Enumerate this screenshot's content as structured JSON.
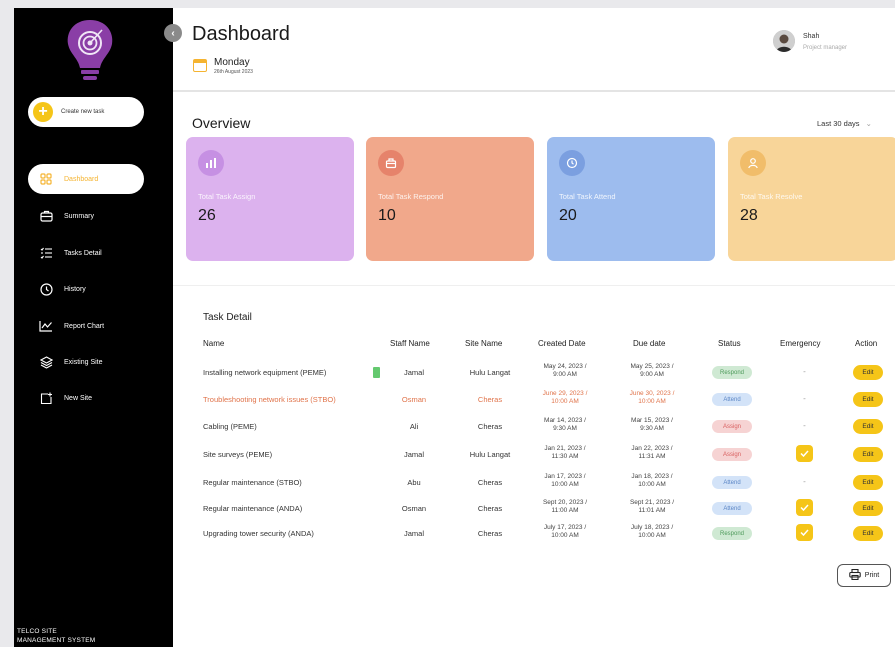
{
  "sidebar": {
    "create_label": "Create new task",
    "items": [
      {
        "label": "Dashboard",
        "icon": "grid-icon"
      },
      {
        "label": "Summary",
        "icon": "briefcase-icon"
      },
      {
        "label": "Tasks Detail",
        "icon": "list-icon"
      },
      {
        "label": "History",
        "icon": "clock-icon"
      },
      {
        "label": "Report Chart",
        "icon": "line-chart-icon"
      },
      {
        "label": "Existing Site",
        "icon": "layers-icon"
      },
      {
        "label": "New Site",
        "icon": "new-site-icon"
      }
    ],
    "footer_line1": "TELCO SITE",
    "footer_line2": "MANAGEMENT SYSTEM"
  },
  "header": {
    "title": "Dashboard",
    "day": "Monday",
    "date": "26th August 2023",
    "user_name": "Shah",
    "user_role": "Project manager"
  },
  "overview": {
    "title": "Overview",
    "range": "Last 30 days",
    "cards": [
      {
        "label": "Total Task Assign",
        "value": "26",
        "bg": "#dcb2ee",
        "icon_bg": "#c690e3"
      },
      {
        "label": "Total Task Respond",
        "value": "10",
        "bg": "#f1a88b",
        "icon_bg": "#e6836b"
      },
      {
        "label": "Total Task Attend",
        "value": "20",
        "bg": "#9dbcee",
        "icon_bg": "#7b9fe0"
      },
      {
        "label": "Total Task Resolve",
        "value": "28",
        "bg": "#f8d599",
        "icon_bg": "#f1bd6a"
      }
    ]
  },
  "task_detail": {
    "title": "Task Detail",
    "columns": [
      "Name",
      "Staff Name",
      "Site Name",
      "Created Date",
      "Due date",
      "Status",
      "Emergency",
      "Action"
    ],
    "rows": [
      {
        "name": "Installing network equipment (PEME)",
        "staff": "Jamal",
        "site": "Hulu Langat",
        "created1": "May 24, 2023 /",
        "created2": "9:00 AM",
        "due1": "May 25, 2023 /",
        "due2": "9:00 AM",
        "status": "Respond",
        "emergency": false,
        "action": "Edit"
      },
      {
        "name": "Troubleshooting network issues (STBO)",
        "staff": "Osman",
        "site": "Cheras",
        "created1": "June 29, 2023 /",
        "created2": "10:00 AM",
        "due1": "June 30, 2023 /",
        "due2": "10:00 AM",
        "status": "Attend",
        "emergency": false,
        "action": "Edit"
      },
      {
        "name": "Cabling (PEME)",
        "staff": "Ali",
        "site": "Cheras",
        "created1": "Mar 14, 2023 /",
        "created2": "9:30 AM",
        "due1": "Mar 15, 2023 /",
        "due2": "9:30 AM",
        "status": "Assign",
        "emergency": false,
        "action": "Edit"
      },
      {
        "name": "Site surveys (PEME)",
        "staff": "Jamal",
        "site": "Hulu Langat",
        "created1": "Jan 21, 2023 /",
        "created2": "11:30 AM",
        "due1": "Jan 22, 2023 /",
        "due2": "11:31 AM",
        "status": "Assign",
        "emergency": true,
        "action": "Edit"
      },
      {
        "name": "Regular maintenance (STBO)",
        "staff": "Abu",
        "site": "Cheras",
        "created1": "Jan 17, 2023 /",
        "created2": "10:00 AM",
        "due1": "Jan 18, 2023 /",
        "due2": "10:00 AM",
        "status": "Attend",
        "emergency": false,
        "action": "Edit"
      },
      {
        "name": "Regular maintenance (ANDA)",
        "staff": "Osman",
        "site": "Cheras",
        "created1": "Sept 20, 2023 /",
        "created2": "11:00 AM",
        "due1": "Sept 21, 2023 /",
        "due2": "11:01 AM",
        "status": "Attend",
        "emergency": true,
        "action": "Edit"
      },
      {
        "name": "Upgrading tower security (ANDA)",
        "staff": "Jamal",
        "site": "Cheras",
        "created1": "July 17, 2023 /",
        "created2": "10:00 AM",
        "due1": "July 18, 2023 /",
        "due2": "10:00 AM",
        "status": "Respond",
        "emergency": true,
        "action": "Edit"
      }
    ],
    "print_label": "Print"
  }
}
